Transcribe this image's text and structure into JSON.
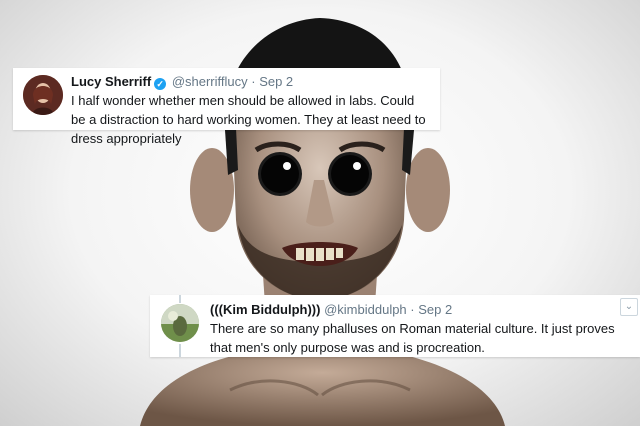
{
  "tweets": [
    {
      "name": "Lucy Sherriff",
      "handle": "@sherrifflucy",
      "date": "· Sep 2",
      "verified": true,
      "text": "I half wonder whether men should be allowed in labs. Could be a distraction to hard working women. They at least need to dress appropriately"
    },
    {
      "name": "(((Kim Biddulph)))",
      "handle": "@kimbiddulph",
      "date": "· Sep 2",
      "verified": false,
      "text": "There are so many phalluses on Roman material culture. It just proves that men's only purpose was and is procreation."
    }
  ],
  "icons": {
    "verified": "verified-check-icon",
    "more": "chevron-down-icon"
  },
  "colors": {
    "accent": "#1da1f2",
    "muted": "#657786",
    "text": "#14171a"
  }
}
